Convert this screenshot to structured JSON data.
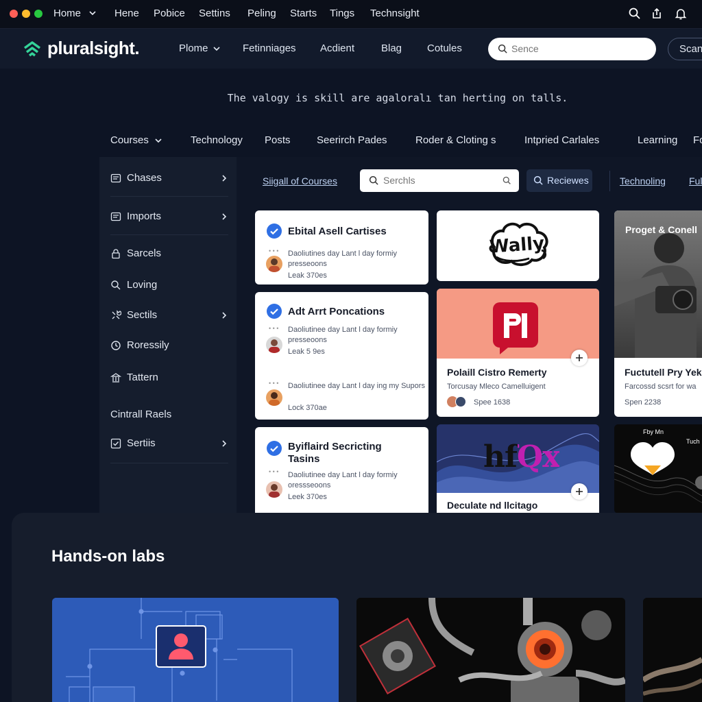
{
  "window": {
    "controls": {
      "close": "#ff5f57",
      "minimize": "#febc2e",
      "maximize": "#28c840"
    },
    "menu": [
      "Home",
      "Hene",
      "Pobice",
      "Settins",
      "Peling",
      "Starts",
      "Tings",
      "Technsight"
    ],
    "icons": [
      "search-icon",
      "share-icon",
      "bell-icon"
    ]
  },
  "header": {
    "logo": "pluralsight.",
    "nav": [
      "Plome",
      "Fetinniages",
      "Acdient",
      "Blag",
      "Cotules"
    ],
    "search": {
      "placeholder": "Sence"
    },
    "scan_label": "Scan"
  },
  "tagline": "The valogy is skill are agaloralı tan herting on talls.",
  "categories": [
    "Courses",
    "Technology",
    "Posts",
    "Seerirch Pades",
    "Roder & Cloting s",
    "Intpried Carlales",
    "Learning",
    "Fo"
  ],
  "sidebar": {
    "items": [
      {
        "label": "Chases",
        "icon": "list-icon",
        "chevron": true
      },
      {
        "label": "Imports",
        "icon": "list-icon",
        "chevron": true
      },
      {
        "label": "Sarcels",
        "icon": "lock-icon",
        "chevron": false
      },
      {
        "label": "Loving",
        "icon": "search-icon",
        "chevron": false
      },
      {
        "label": "Sectils",
        "icon": "wrench-icon",
        "chevron": true
      },
      {
        "label": "Roressily",
        "icon": "clock-icon",
        "chevron": false
      },
      {
        "label": "Tattern",
        "icon": "bank-icon",
        "chevron": false
      }
    ],
    "section_title": "Cintrall Raels",
    "footer_item": {
      "label": "Sertiis",
      "icon": "checkbox-icon",
      "chevron": true
    }
  },
  "toolbar": {
    "link_left": "Siigall of Courses",
    "search": {
      "placeholder": "Serchls"
    },
    "reviews_label": "Reciewes",
    "link_right": "Technoling",
    "link_far": "Full"
  },
  "courses": [
    {
      "title": "Ebital Asell Cartises",
      "description": "Daoliutines day Lant l day formiy presseoons",
      "meta": "Leak 370es"
    },
    {
      "title": "Adt Arrt Poncations",
      "description": "Daoliutinee day Lant l day formiy presseoons",
      "meta": "Leak 5 9es",
      "extra": {
        "description": "Daoliutinee day Lant l day ing my Supors",
        "meta": "Lock 370ae"
      }
    },
    {
      "title": "Byiflaird Secricting Tasins",
      "description": "Daoliutinee day Lant l day formiy oressseoons",
      "meta": "Leek 370es"
    }
  ],
  "promos": [
    {
      "logo_text": "Wally"
    },
    {
      "title": "Polaill Cistro Remerty",
      "subtitle": "Torcusay Mleco Camelluigent",
      "meta": "Spee 1638",
      "accent": "#f59a84"
    },
    {
      "logo_text": "hfQx",
      "title": "Deculate nd llcitago"
    }
  ],
  "features": [
    {
      "title": "Proget & Conell",
      "subtitle": "Fuctutell Pry Yek",
      "description": "Farcossd scsrt for wa",
      "meta": "Spen 2238"
    },
    {
      "caption_left": "Fby Mn",
      "caption_right": "Tuch"
    }
  ],
  "labs": {
    "title": "Hands-on labs"
  },
  "colors": {
    "accent_green": "#34d399",
    "check_blue": "#2f6fe4",
    "lab_blue": "#2d5bb8"
  }
}
